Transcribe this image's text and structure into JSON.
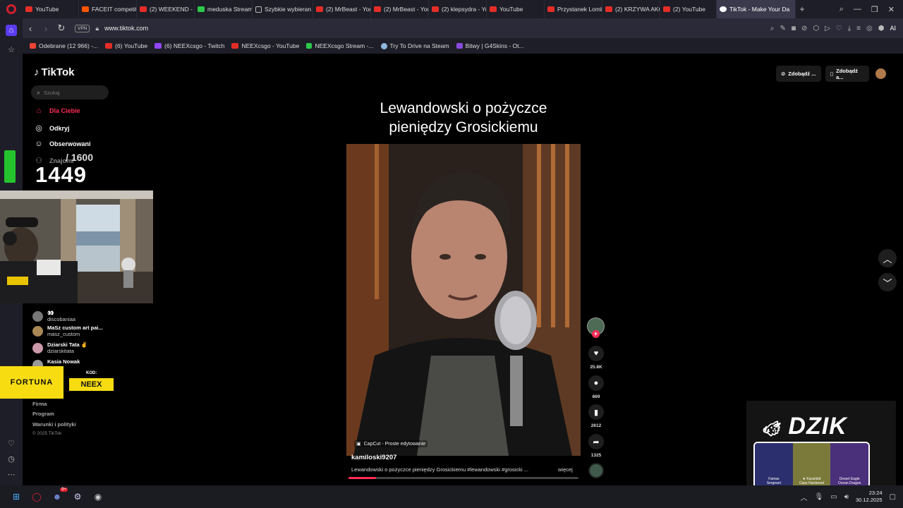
{
  "tabs": [
    {
      "label": "YouTube",
      "icon": "youtube-icon",
      "active": false
    },
    {
      "label": "FACEIT competiti",
      "icon": "faceit-icon",
      "active": false
    },
    {
      "label": "(2) WEEKEND - H",
      "icon": "youtube-icon",
      "active": false
    },
    {
      "label": "meduska Stream",
      "icon": "kick-icon",
      "active": false
    },
    {
      "label": "Szybkie wybieran",
      "icon": "speed-dial-icon",
      "active": false
    },
    {
      "label": "(2) MrBeast - You",
      "icon": "youtube-icon",
      "active": false
    },
    {
      "label": "(2) MrBeast - You",
      "icon": "youtube-icon",
      "active": false
    },
    {
      "label": "(2) klepsydra - Yo",
      "icon": "youtube-icon",
      "active": false
    },
    {
      "label": "YouTube",
      "icon": "youtube-icon",
      "active": false
    },
    {
      "label": "Przystanek Lomb",
      "icon": "youtube-icon",
      "active": false
    },
    {
      "label": "(2) KRZYWA AKC",
      "icon": "youtube-icon",
      "active": false
    },
    {
      "label": "(2) YouTube",
      "icon": "youtube-icon",
      "active": false
    },
    {
      "label": "TikTok - Make Your Da",
      "icon": "tiktok-icon",
      "active": true
    }
  ],
  "address": {
    "vpn": "VPN",
    "url": "www.tiktok.com",
    "ai": "AI"
  },
  "bookmarks": [
    {
      "label": "Odebrane (12 966) -...",
      "icon": "gmail-icon"
    },
    {
      "label": "(6) YouTube",
      "icon": "youtube-icon"
    },
    {
      "label": "(6) NEEXcsgo - Twitch",
      "icon": "twitch-icon"
    },
    {
      "label": "NEEXcsgo - YouTube",
      "icon": "youtube-icon"
    },
    {
      "label": "NEEXcsgo Stream -...",
      "icon": "kick-icon"
    },
    {
      "label": "Try To Drive na Steam",
      "icon": "steam-icon"
    },
    {
      "label": "Bitwy | G4Skins - Ot...",
      "icon": "g4skins-icon"
    }
  ],
  "tiktok": {
    "logo": "TikTok",
    "search_placeholder": "Szukaj",
    "nav": {
      "for_you": "Dla Ciebie",
      "explore": "Odkryj",
      "following": "Obserwowani",
      "friends": "Znajomi"
    },
    "following_accounts": [
      {
        "name": "👀",
        "handle": "discobaniaa"
      },
      {
        "name": "MaSz custom art pai...",
        "handle": "masz_custom"
      },
      {
        "name": "Dziarski Tata ✌️",
        "handle": "dziarskitata"
      },
      {
        "name": "Kasia Nowak",
        "handle": ""
      }
    ],
    "footer": {
      "company": "Firma",
      "program": "Program",
      "terms": "Warunki i polityki",
      "copyright": "© 2025 TikTok"
    },
    "get_coins": "Zdobądź ...",
    "get_app": "Zdobądź a..."
  },
  "video": {
    "title_line1": "Lewandowski o pożyczce",
    "title_line2": "pieniędzy Grosickiemu",
    "capcut": "CapCut - Proste edytowanie",
    "author": "kamiloski9207",
    "caption": "Lewandowski o pożyczce pieniędzy Grosickiemu #lewandowski #grosicki ...",
    "more": "więcej",
    "progress": 0.12,
    "likes": "25.8K",
    "comments": "669",
    "saves": "2612",
    "shares": "1325"
  },
  "overlay": {
    "counter_current": "1449",
    "counter_total": "/ 1600",
    "fortuna": "FORTUNA",
    "fortuna_code_label": "KOD:",
    "fortuna_code": "NEEX",
    "dzik": "DZIK",
    "skins": [
      {
        "name": "Famas",
        "sub": "Sergeant"
      },
      {
        "name": "★ Karambit",
        "sub": "Case Hardened"
      },
      {
        "name": "Desert Eagle",
        "sub": "Ocean Dragon"
      }
    ]
  },
  "taskbar": {
    "time": "23:24",
    "date": "30.12.2025",
    "discord_badge": "9+"
  },
  "colors": {
    "accent": "#fe2c55",
    "fortuna": "#f7dc12",
    "progress": "#fe2c55"
  }
}
